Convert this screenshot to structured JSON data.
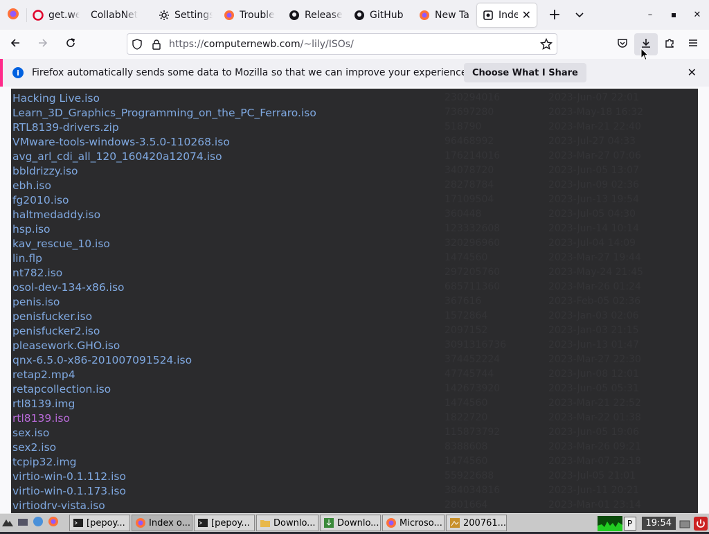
{
  "tabs": [
    {
      "label": "get.wel",
      "icon": "opera-icon",
      "width": 84
    },
    {
      "label": "CollabNet",
      "icon": "none",
      "width": 98
    },
    {
      "label": "Settings",
      "icon": "gear-icon",
      "width": 94
    },
    {
      "label": "Trouble",
      "icon": "firefox-icon",
      "width": 94
    },
    {
      "label": "Release",
      "icon": "github-icon",
      "width": 94
    },
    {
      "label": "GitHub",
      "icon": "github-icon",
      "width": 94
    },
    {
      "label": "New Ta",
      "icon": "firefox-icon",
      "width": 92
    }
  ],
  "active_tab": {
    "label": "Index"
  },
  "url": {
    "prefix": "https://",
    "host": "computernewb.com",
    "path": "/~lily/ISOs/"
  },
  "notification": {
    "message": "Firefox automatically sends some data to Mozilla so that we can improve your experience.",
    "button": "Choose What I Share"
  },
  "files": [
    {
      "name": "Hacking Live.iso",
      "size": "230294016",
      "date": "2023-Jun-07 22:01"
    },
    {
      "name": "Learn_3D_Graphics_Programming_on_the_PC_Ferraro.iso",
      "size": "73697280",
      "date": "2023-May-18 16:32"
    },
    {
      "name": "RTL8139-drivers.zip",
      "size": "518790",
      "date": "2023-Mar-21 22:40"
    },
    {
      "name": "VMware-tools-windows-3.5.0-110268.iso",
      "size": "96468992",
      "date": "2023-Jul-27 04:33"
    },
    {
      "name": "avg_arl_cdi_all_120_160420a12074.iso",
      "size": "176214016",
      "date": "2023-Mar-27 07:06"
    },
    {
      "name": "bbldrizzy.iso",
      "size": "34078720",
      "date": "2023-Jun-05 13:07"
    },
    {
      "name": "ebh.iso",
      "size": "28278784",
      "date": "2023-Jun-09 02:36"
    },
    {
      "name": "fg2010.iso",
      "size": "17109504",
      "date": "2023-Jun-13 19:54"
    },
    {
      "name": "haltmedaddy.iso",
      "size": "360448",
      "date": "2023-Jul-05 04:30"
    },
    {
      "name": "hsp.iso",
      "size": "123332608",
      "date": "2023-Jun-14 10:14"
    },
    {
      "name": "kav_rescue_10.iso",
      "size": "320296960",
      "date": "2023-Jul-04 14:09"
    },
    {
      "name": "lin.flp",
      "size": "1474560",
      "date": "2023-Mar-27 19:44"
    },
    {
      "name": "nt782.iso",
      "size": "297205760",
      "date": "2023-May-24 21:45"
    },
    {
      "name": "osol-dev-134-x86.iso",
      "size": "685711360",
      "date": "2023-Mar-26 01:24"
    },
    {
      "name": "penis.iso",
      "size": "367616",
      "date": "2023-Feb-05 02:36"
    },
    {
      "name": "penisfucker.iso",
      "size": "1572864",
      "date": "2023-Jan-03 02:06"
    },
    {
      "name": "penisfucker2.iso",
      "size": "2097152",
      "date": "2023-Jan-03 21:15"
    },
    {
      "name": "pleasework.GHO.iso",
      "size": "3091316736",
      "date": "2023-Jun-13 01:47"
    },
    {
      "name": "qnx-6.5.0-x86-201007091524.iso",
      "size": "374452224",
      "date": "2023-Mar-27 22:30"
    },
    {
      "name": "retap2.mp4",
      "size": "47745744",
      "date": "2023-Jun-08 12:01"
    },
    {
      "name": "retapcollection.iso",
      "size": "142673920",
      "date": "2023-Jun-05 05:31"
    },
    {
      "name": "rtl8139.img",
      "size": "1474560",
      "date": "2023-Mar-21 22:52"
    },
    {
      "name": "rtl8139.iso",
      "size": "1822720",
      "date": "2023-Mar-22 01:38",
      "visited": true
    },
    {
      "name": "sex.iso",
      "size": "115873792",
      "date": "2023-Jun-05 19:06"
    },
    {
      "name": "sex2.iso",
      "size": "8388608",
      "date": "2023-Mar-26 09:21"
    },
    {
      "name": "tcpip32.img",
      "size": "1474560",
      "date": "2023-Mar-07 22:18"
    },
    {
      "name": "virtio-win-0.1.112.iso",
      "size": "55922688",
      "date": "2023-Jul-05 21:01"
    },
    {
      "name": "virtio-win-0.1.173.iso",
      "size": "384034816",
      "date": "2023-Jun-11 20:21"
    },
    {
      "name": "virtiodrv-vista.iso",
      "size": "2801664",
      "date": "2023-Mar-01 23:14"
    }
  ],
  "taskbar": {
    "tasks": [
      {
        "label": "[pepoy...",
        "icon": "terminal-icon"
      },
      {
        "label": "Index o...",
        "icon": "firefox-icon",
        "active": true
      },
      {
        "label": "[pepoy...",
        "icon": "terminal-icon"
      },
      {
        "label": "Downlo...",
        "icon": "folder-icon"
      },
      {
        "label": "Downlo...",
        "icon": "download-icon"
      },
      {
        "label": "Microso...",
        "icon": "firefox-icon"
      },
      {
        "label": "200761...",
        "icon": "image-icon"
      }
    ],
    "clock": "19:54"
  },
  "colors": {
    "link": "#7fa8e0",
    "visited": "#b86ad8",
    "page_bg": "#2b2b2d",
    "accent": "#ff2a8a"
  }
}
